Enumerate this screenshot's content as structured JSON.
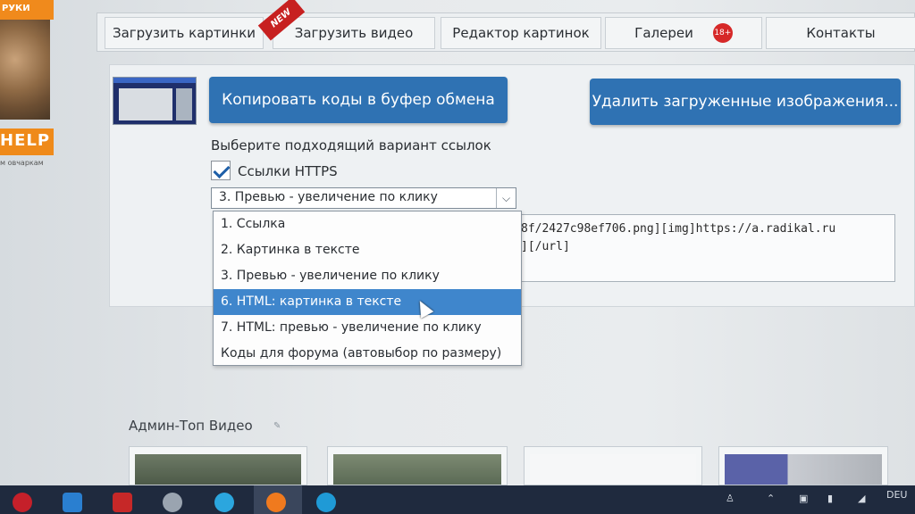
{
  "ad": {
    "top_text": "РУКИ",
    "help_text": "HELP",
    "sub_text": "м овчаркам"
  },
  "nav": {
    "items": [
      {
        "label": "Загрузить картинки"
      },
      {
        "label": "Загрузить видео"
      },
      {
        "label": "Редактор картинок"
      },
      {
        "label": "Галереи"
      },
      {
        "label": "Контакты"
      }
    ],
    "new_ribbon": "NEW",
    "age_badge": "18+"
  },
  "panel": {
    "copy_button": "Копировать коды в буфер обмена",
    "delete_button": "Удалить загруженные изображения...",
    "choose_label": "Выберите подходящий вариант ссылок",
    "https_label": "Ссылки HTTPS",
    "https_checked": true,
    "select_value": "3. Превью - увеличение по клику",
    "code_line1": "8f/2427c98ef706.png][img]https://a.radikal.ru",
    "code_line2": "][/url]"
  },
  "dropdown": {
    "options": [
      {
        "label": "1. Ссылка",
        "selected": false
      },
      {
        "label": "2. Картинка в тексте",
        "selected": false
      },
      {
        "label": "3. Превью - увеличение по клику",
        "selected": false
      },
      {
        "label": "6. HTML: картинка в тексте",
        "selected": true
      },
      {
        "label": "7. HTML: превью - увеличение по клику",
        "selected": false
      },
      {
        "label": "Коды для форума (автовыбор по размеру)",
        "selected": false
      }
    ]
  },
  "section": {
    "title": "Админ-Топ Видео"
  },
  "taskbar": {
    "icons": [
      "opera-icon",
      "mail-icon",
      "acrobat-icon",
      "paint-icon",
      "skype-icon",
      "firefox-icon",
      "edge-icon"
    ],
    "lang": "DEU"
  },
  "colors": {
    "button_blue": "#2f72b3",
    "selection_blue": "#3f86cc",
    "badge_red": "#d62828",
    "taskbar": "#1f2a3e"
  }
}
